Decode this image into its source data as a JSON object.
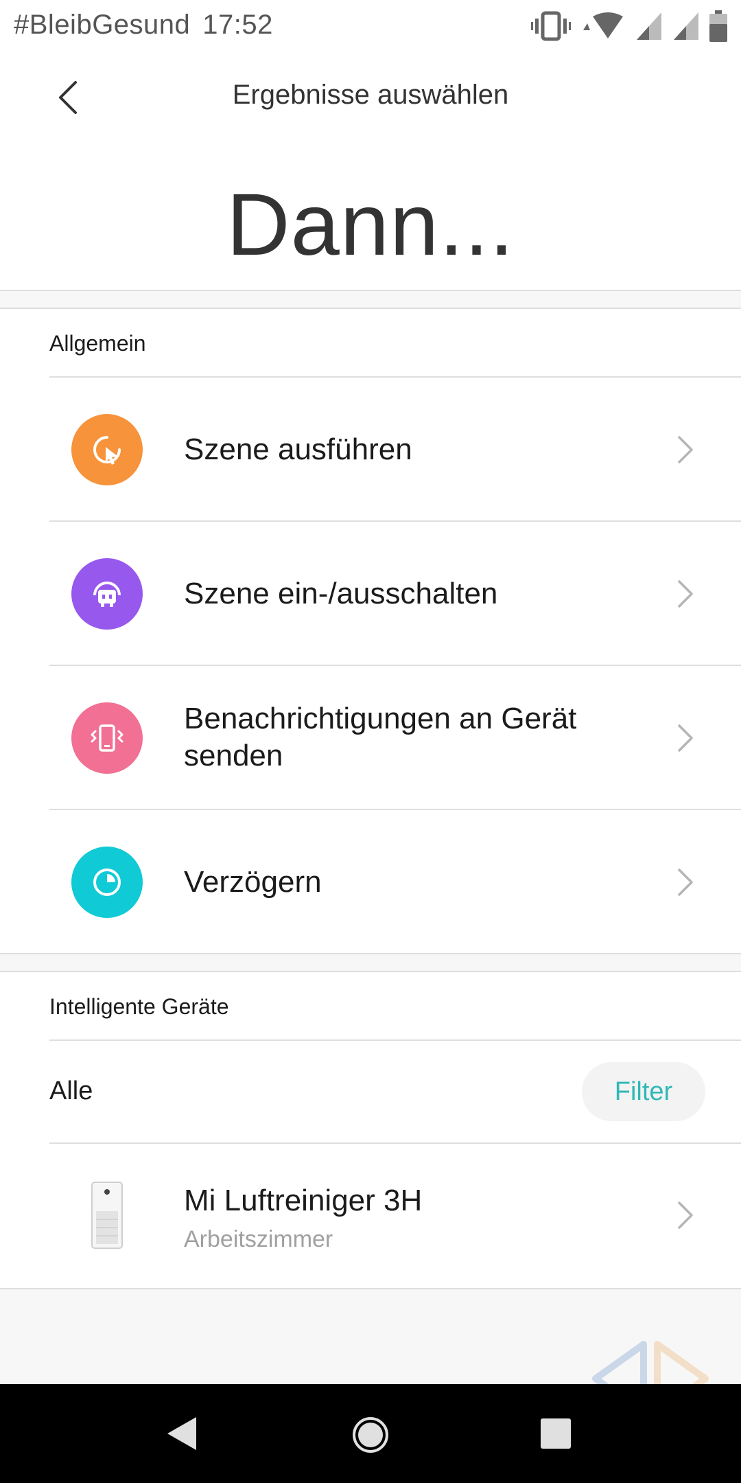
{
  "status_bar": {
    "notification_text": "#BleibGesund",
    "time": "17:52",
    "icons": [
      "vibrate-icon",
      "wifi-icon",
      "signal-icon",
      "signal-icon",
      "battery-icon"
    ]
  },
  "header": {
    "title": "Ergebnisse auswählen",
    "heading": "Dann..."
  },
  "general": {
    "label": "Allgemein",
    "items": [
      {
        "label": "Szene ausführen",
        "icon": "cursor-click-icon",
        "color": "#f7933b"
      },
      {
        "label": "Szene ein-/ausschalten",
        "icon": "robot-icon",
        "color": "#9758ee"
      },
      {
        "label": "Benachrichtigungen an Gerät senden",
        "icon": "phone-vibrate-icon",
        "color": "#f17093"
      },
      {
        "label": "Verzögern",
        "icon": "clock-icon",
        "color": "#10cad6"
      }
    ]
  },
  "smart_devices": {
    "label": "Intelligente Geräte",
    "filter_scope": "Alle",
    "filter_button": "Filter",
    "devices": [
      {
        "name": "Mi Luftreiniger 3H",
        "room": "Arbeitszimmer",
        "icon": "air-purifier-icon"
      }
    ]
  },
  "colors": {
    "accent": "#2fb8b6"
  }
}
